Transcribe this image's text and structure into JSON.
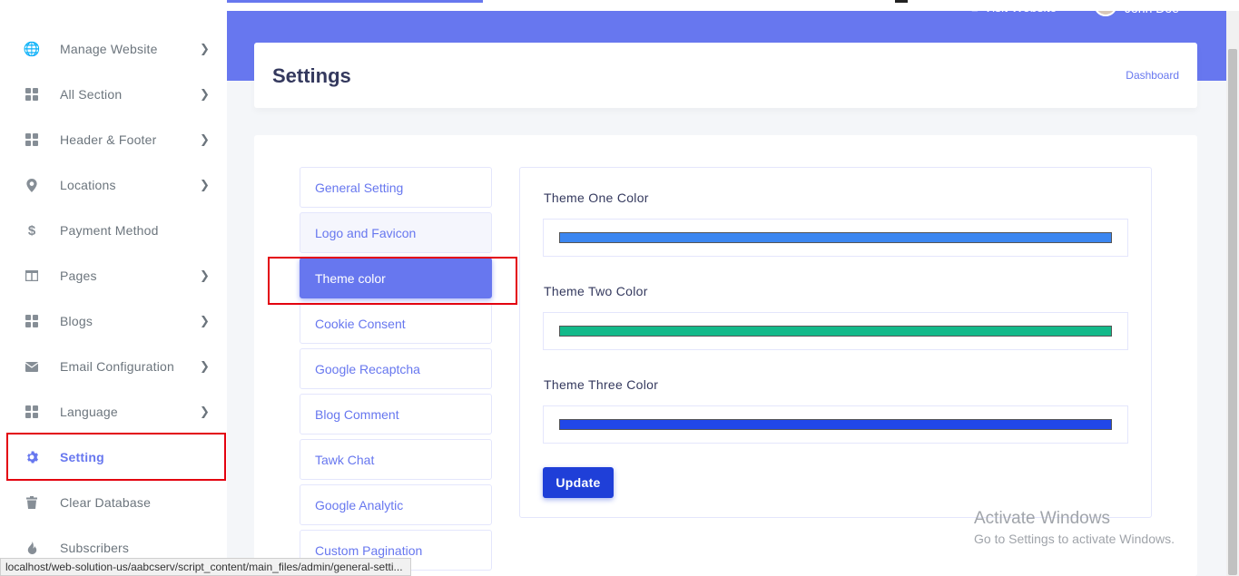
{
  "header": {
    "visit_label": "Visit Website",
    "user_name": "John Doe"
  },
  "sidebar": {
    "items": [
      {
        "label": "Manage Website",
        "icon": "globe-icon",
        "chevron": true
      },
      {
        "label": "All Section",
        "icon": "grid-icon",
        "chevron": true
      },
      {
        "label": "Header & Footer",
        "icon": "grid-icon",
        "chevron": true
      },
      {
        "label": "Locations",
        "icon": "map-pin-icon",
        "chevron": true
      },
      {
        "label": "Payment Method",
        "icon": "dollar-icon",
        "chevron": false
      },
      {
        "label": "Pages",
        "icon": "columns-icon",
        "chevron": true
      },
      {
        "label": "Blogs",
        "icon": "grid-icon",
        "chevron": true
      },
      {
        "label": "Email Configuration",
        "icon": "envelope-icon",
        "chevron": true
      },
      {
        "label": "Language",
        "icon": "grid-icon",
        "chevron": true
      },
      {
        "label": "Setting",
        "icon": "gear-icon",
        "chevron": false,
        "active": true
      },
      {
        "label": "Clear Database",
        "icon": "trash-icon",
        "chevron": false
      },
      {
        "label": "Subscribers",
        "icon": "fire-icon",
        "chevron": false
      }
    ]
  },
  "page": {
    "title": "Settings",
    "breadcrumb": "Dashboard"
  },
  "tabs": [
    "General Setting",
    "Logo and Favicon",
    "Theme color",
    "Cookie Consent",
    "Google Recaptcha",
    "Blog Comment",
    "Tawk Chat",
    "Google Analytic",
    "Custom Pagination"
  ],
  "active_tab": "Theme color",
  "theme_colors": [
    {
      "label": "Theme One Color",
      "value": "#3b86f0"
    },
    {
      "label": "Theme Two Color",
      "value": "#13b98a"
    },
    {
      "label": "Theme Three Color",
      "value": "#2147e8"
    }
  ],
  "update_label": "Update",
  "watermark": {
    "line1": "Activate Windows",
    "line2": "Go to Settings to activate Windows."
  },
  "status_url": "localhost/web-solution-us/aabcserv/script_content/main_files/admin/general-setti..."
}
